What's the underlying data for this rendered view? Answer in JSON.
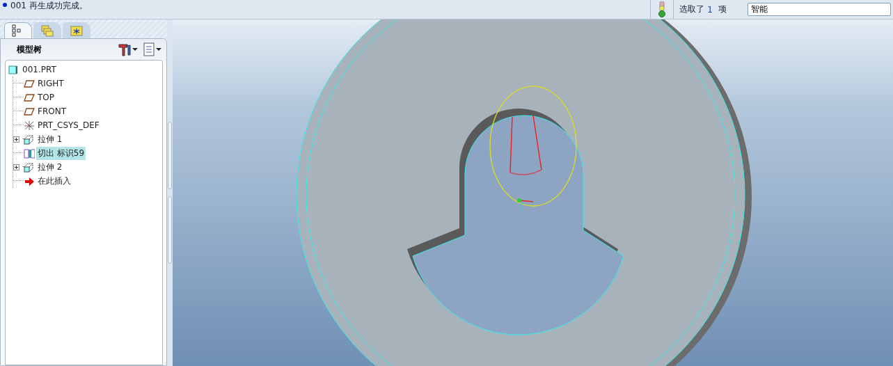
{
  "message_area": {
    "message": "001 再生成功完成。"
  },
  "status_bar": {
    "selected_label": "选取了",
    "selected_count": "1",
    "selected_unit": "项",
    "filter": {
      "value": "智能"
    }
  },
  "navigator_tabs": [
    {
      "kind": "model-tree",
      "selected": true
    },
    {
      "kind": "folders",
      "selected": false
    },
    {
      "kind": "favorites",
      "selected": false
    }
  ],
  "model_tree": {
    "title": "模型树",
    "items": [
      {
        "label": "001.PRT",
        "kind": "part",
        "selected": false,
        "children": [
          {
            "label": "RIGHT",
            "kind": "datum-plane",
            "selected": false
          },
          {
            "label": "TOP",
            "kind": "datum-plane",
            "selected": false
          },
          {
            "label": "FRONT",
            "kind": "datum-plane",
            "selected": false
          },
          {
            "label": "PRT_CSYS_DEF",
            "kind": "csys",
            "selected": false
          },
          {
            "label": "拉伸 1",
            "kind": "extrude",
            "selected": false,
            "collapsed": true
          },
          {
            "label": "切出 标识59",
            "kind": "cut",
            "selected": true
          },
          {
            "label": "拉伸 2",
            "kind": "extrude",
            "selected": false,
            "collapsed": true
          },
          {
            "label": "在此插入",
            "kind": "insert",
            "selected": false
          }
        ]
      }
    ]
  }
}
